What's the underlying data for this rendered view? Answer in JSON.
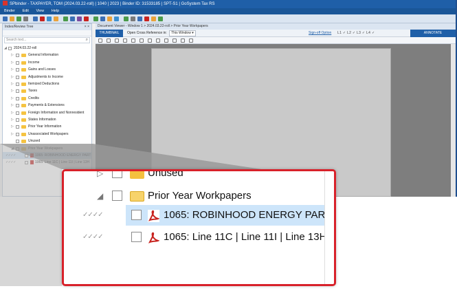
{
  "app": {
    "title": "SPbinder - TAXPAYER, TOM (2024.03.22-roll) | 1040 | 2023 | Binder ID: 31533185 | SPT-S1 | GoSystem Tax RS",
    "menu": [
      "Binder",
      "Edit",
      "View",
      "Help"
    ]
  },
  "left_panel": {
    "title": "Index/Review Tree",
    "search_placeholder": "Search text...",
    "root_label": "2024.03.22-roll",
    "items": [
      {
        "label": "General Information"
      },
      {
        "label": "Income"
      },
      {
        "label": "Gains and Losses"
      },
      {
        "label": "Adjustments to Income"
      },
      {
        "label": "Itemized Deductions"
      },
      {
        "label": "Taxes"
      },
      {
        "label": "Credits"
      },
      {
        "label": "Payments & Extensions"
      },
      {
        "label": "Foreign Information and Nonresident"
      },
      {
        "label": "States Information"
      },
      {
        "label": "Prior Year Information"
      },
      {
        "label": "Unassociated Workpapers"
      },
      {
        "label": "Unused"
      },
      {
        "label": "Prior Year Workpapers"
      },
      {
        "label": "1065: ROBINHOOD ENERGY PART",
        "marks": "✓✓✓✓"
      },
      {
        "label": "1065: Line 11C | Line 11I | Line 13H",
        "marks": "✓✓✓✓"
      }
    ]
  },
  "viewer": {
    "title": "Document Viewer - Window 1 > 2024.03.22-roll > Prior Year Workpapers",
    "thumbnail_tab": "THUMBNAIL",
    "cross_ref_label": "Open Cross Reference in:",
    "cross_ref_value": "This Window",
    "signoff_option": "Sign-off Option",
    "levels": "L1 ✓  L2 ✓  L3 ✓  L4 ✓",
    "annotate_label": "ANNOTATE"
  },
  "zoom": {
    "rows": [
      {
        "label": "Unused"
      },
      {
        "label": "Prior Year Workpapers"
      },
      {
        "label": "1065: ROBINHOOD ENERGY PART",
        "marks": "✓✓✓✓"
      },
      {
        "label": "1065: Line 11C | Line 11I | Line 13H",
        "marks": "✓✓✓✓"
      }
    ]
  },
  "colors": {
    "accent": "#1f5fa8",
    "callout_border": "#d8212a",
    "folder": "#f4c03e",
    "pdf": "#c8231f",
    "selection": "#cde5fa"
  }
}
